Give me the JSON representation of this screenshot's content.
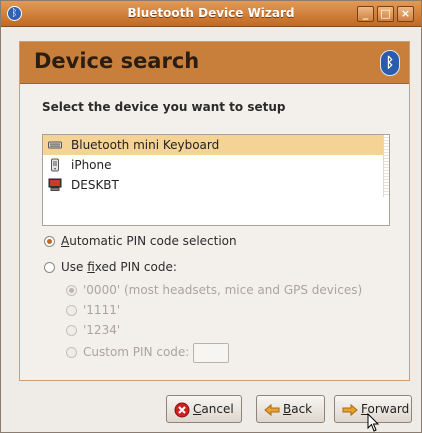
{
  "window": {
    "title": "Bluetooth Device Wizard",
    "controls": {
      "minimize": "_",
      "maximize": "□",
      "close": "×"
    }
  },
  "banner": {
    "title": "Device search"
  },
  "instructions": "Select the device you want to setup",
  "devices": [
    {
      "name": "Bluetooth mini Keyboard",
      "icon": "keyboard-icon",
      "selected": true
    },
    {
      "name": "iPhone",
      "icon": "phone-icon",
      "selected": false
    },
    {
      "name": "DESKBT",
      "icon": "computer-icon",
      "selected": false
    }
  ],
  "pin": {
    "automatic": {
      "mnemonic": "A",
      "rest": "utomatic PIN code selection",
      "checked": true
    },
    "fixed": {
      "prefix": "Use ",
      "mnemonic": "f",
      "rest": "ixed PIN code:",
      "checked": false
    },
    "fixed_options": [
      {
        "label": "'0000' (most headsets, mice and GPS devices)",
        "checked": true
      },
      {
        "label": "'1111'",
        "checked": false
      },
      {
        "label": "'1234'",
        "checked": false
      },
      {
        "label": "Custom PIN code:",
        "checked": false
      }
    ],
    "custom_value": ""
  },
  "buttons": {
    "cancel": {
      "mnemonic": "C",
      "rest": "ancel"
    },
    "back": {
      "mnemonic": "B",
      "rest": "ack"
    },
    "forward": {
      "mnemonic": "F",
      "rest": "orward"
    }
  },
  "colors": {
    "titlebar": "#c06a24",
    "banner": "#c97f3c",
    "selection": "#f4d394",
    "accent_radio": "#c4651f"
  }
}
